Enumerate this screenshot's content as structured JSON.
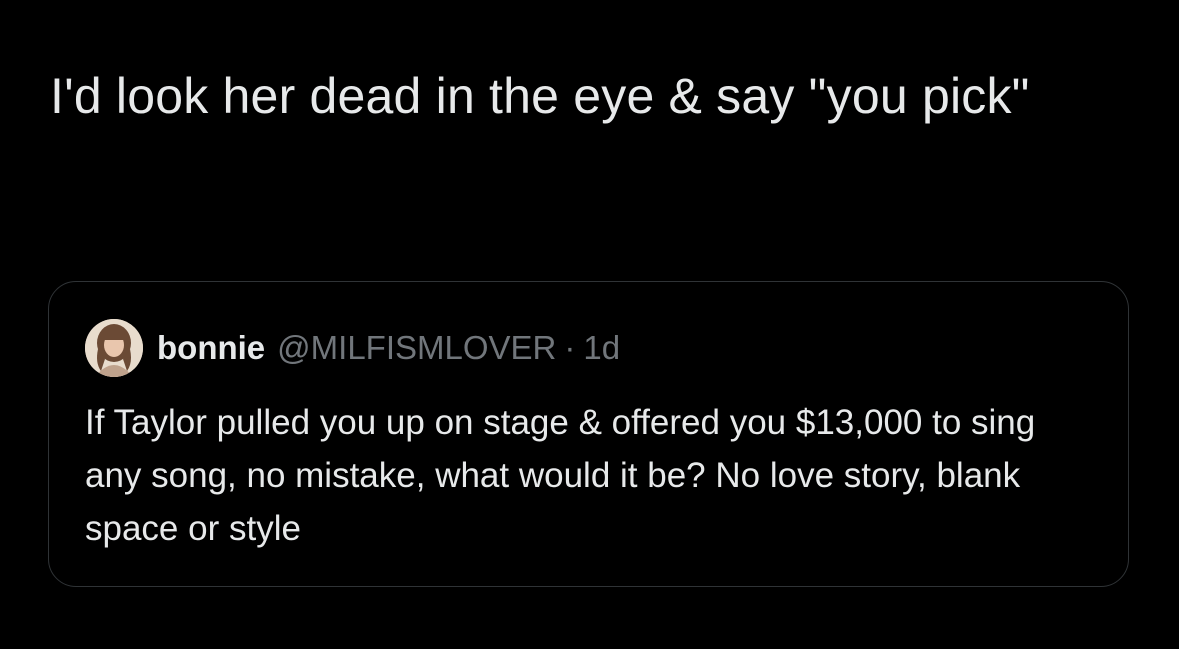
{
  "tweet": {
    "text": "I'd look her dead in the eye & say \"you pick\""
  },
  "quoted_tweet": {
    "author_name": "bonnie",
    "author_handle": "@MILFISMLOVER",
    "separator": "·",
    "timestamp": "1d",
    "text": "If Taylor pulled you up on stage & offered you $13,000 to sing any song, no mistake, what would it be? No love story, blank space or style"
  },
  "colors": {
    "background": "#000000",
    "text_primary": "#e7e9ea",
    "text_secondary": "#71767b",
    "card_border": "#2f3336"
  }
}
